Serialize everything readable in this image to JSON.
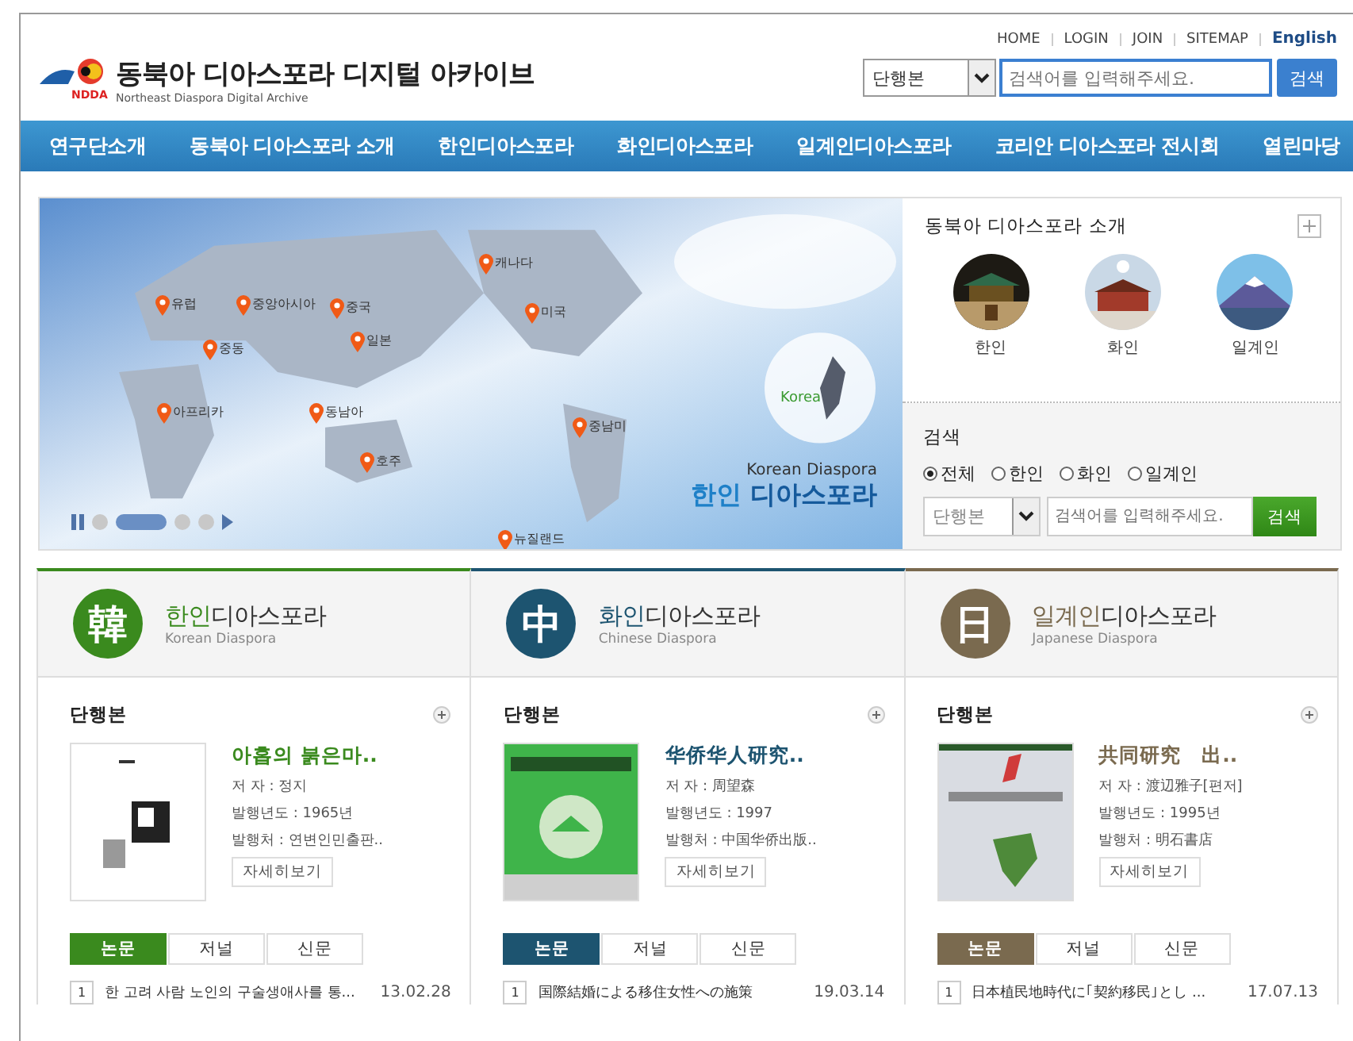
{
  "top_links": [
    {
      "label": "HOME",
      "kind": "link"
    },
    {
      "label": "LOGIN",
      "kind": "link"
    },
    {
      "label": "JOIN",
      "kind": "link"
    },
    {
      "label": "SITEMAP",
      "kind": "link"
    },
    {
      "label": "English",
      "kind": "lang"
    }
  ],
  "logo": {
    "mark": "NDDA",
    "title": "동북아 디아스포라 디지털 아카이브",
    "subtitle": "Northeast Diaspora Digital Archive"
  },
  "search": {
    "select": "단행본",
    "placeholder": "검색어를 입력해주세요.",
    "button": "검색"
  },
  "nav": [
    "연구단소개",
    "동북아 디아스포라 소개",
    "한인디아스포라",
    "화인디아스포라",
    "일계인디아스포라",
    "코리안 디아스포라 전시회",
    "열린마당"
  ],
  "banner": {
    "pins": [
      "유럽",
      "중앙아시아",
      "중국",
      "일본",
      "중동",
      "아프리카",
      "동남아",
      "호주",
      "캐나다",
      "미국",
      "중남미",
      "뉴질랜드"
    ],
    "badge": "Korea",
    "caption_en": "Korean Diaspora",
    "caption_a": "한인",
    "caption_b": "디아스포라",
    "dots": [
      {
        "selected": false
      },
      {
        "selected": true
      },
      {
        "selected": false
      },
      {
        "selected": false
      }
    ]
  },
  "intro": {
    "title": "동북아 디아스포라 소개",
    "items": [
      {
        "label": "한인"
      },
      {
        "label": "화인"
      },
      {
        "label": "일계인"
      }
    ]
  },
  "side_search": {
    "title": "검색",
    "options": [
      {
        "label": "전체",
        "selected": true
      },
      {
        "label": "한인",
        "selected": false
      },
      {
        "label": "화인",
        "selected": false
      },
      {
        "label": "일계인",
        "selected": false
      }
    ],
    "select": "단행본",
    "placeholder": "검색어를 입력해주세요.",
    "button": "검색"
  },
  "columns": [
    {
      "color": "#3a8a1e",
      "glyph": "韓",
      "title_a": "한인",
      "title_b": "디아스포라",
      "subtitle": "Korean Diaspora",
      "section": "단행본",
      "book": {
        "title": "아홉의 붉은마..",
        "author": "저 자 : 정지",
        "year": "발행년도 : 1965년",
        "publisher": "발행처 : 연변인민출판..",
        "button": "자세히보기"
      },
      "tabs": [
        {
          "label": "논문",
          "selected": true
        },
        {
          "label": "저널",
          "selected": false
        },
        {
          "label": "신문",
          "selected": false
        }
      ],
      "item": {
        "num": "1",
        "text": "한 고려 사람 노인의 구술생애사를 통...",
        "date": "13.02.28"
      }
    },
    {
      "color": "#1d5470",
      "glyph": "中",
      "title_a": "화인",
      "title_b": "디아스포라",
      "subtitle": "Chinese Diaspora",
      "section": "단행본",
      "book": {
        "title": "华侨华人研究..",
        "author": "저 자 : 周望森",
        "year": "발행년도 : 1997",
        "publisher": "발행처 : 中国华侨出版..",
        "button": "자세히보기"
      },
      "tabs": [
        {
          "label": "논문",
          "selected": true
        },
        {
          "label": "저널",
          "selected": false
        },
        {
          "label": "신문",
          "selected": false
        }
      ],
      "item": {
        "num": "1",
        "text": "国際結婚による移住女性への施策",
        "date": "19.03.14"
      }
    },
    {
      "color": "#7a6a4f",
      "glyph": "日",
      "title_a": "일계인",
      "title_b": "디아스포라",
      "subtitle": "Japanese Diaspora",
      "section": "단행본",
      "book": {
        "title": "共同研究　出..",
        "author": "저 자 : 渡辺雅子[편저]",
        "year": "발행년도 : 1995년",
        "publisher": "발행처 : 明石書店",
        "button": "자세히보기"
      },
      "tabs": [
        {
          "label": "논문",
          "selected": true
        },
        {
          "label": "저널",
          "selected": false
        },
        {
          "label": "신문",
          "selected": false
        }
      ],
      "item": {
        "num": "1",
        "text": "日本植民地時代に｢契約移民｣とし ...",
        "date": "17.07.13"
      }
    }
  ]
}
